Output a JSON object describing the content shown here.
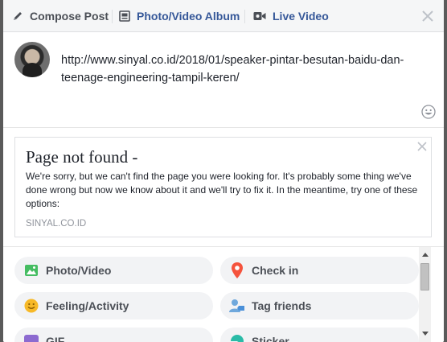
{
  "tabs": {
    "compose": {
      "label": "Compose Post",
      "icon": "pencil-icon"
    },
    "album": {
      "label": "Photo/Video Album",
      "icon": "album-icon"
    },
    "live": {
      "label": "Live Video",
      "icon": "video-camera-icon"
    },
    "close_icon": "close-icon"
  },
  "composer": {
    "text": "http://www.sinyal.co.id/2018/01/speaker-pintar-besutan-baidu-dan-teenage-engineering-tampil-keren/",
    "emoji_icon": "smiley-icon"
  },
  "preview": {
    "title": "Page not found -",
    "description": "We're sorry, but we can't find the page you were looking for. It's probably some thing we've done wrong but now we know about it and we'll try to fix it. In the meantime, try one of these options:",
    "domain": "SINYAL.CO.ID"
  },
  "actions": [
    {
      "label": "Photo/Video",
      "icon": "photo-icon",
      "color": "#45bd62"
    },
    {
      "label": "Check in",
      "icon": "location-pin-icon",
      "color": "#f5533d"
    },
    {
      "label": "Feeling/Activity",
      "icon": "smiley-face-icon",
      "color": "#f7b928"
    },
    {
      "label": "Tag friends",
      "icon": "tag-person-icon",
      "color": "#1877f2"
    },
    {
      "label": "GIF",
      "icon": "gif-icon",
      "color": "#8c6ad0"
    },
    {
      "label": "Sticker",
      "icon": "sticker-icon",
      "color": "#2abba7"
    }
  ],
  "colors": {
    "link": "#365899",
    "muted": "#90949c",
    "text": "#1d2129"
  }
}
